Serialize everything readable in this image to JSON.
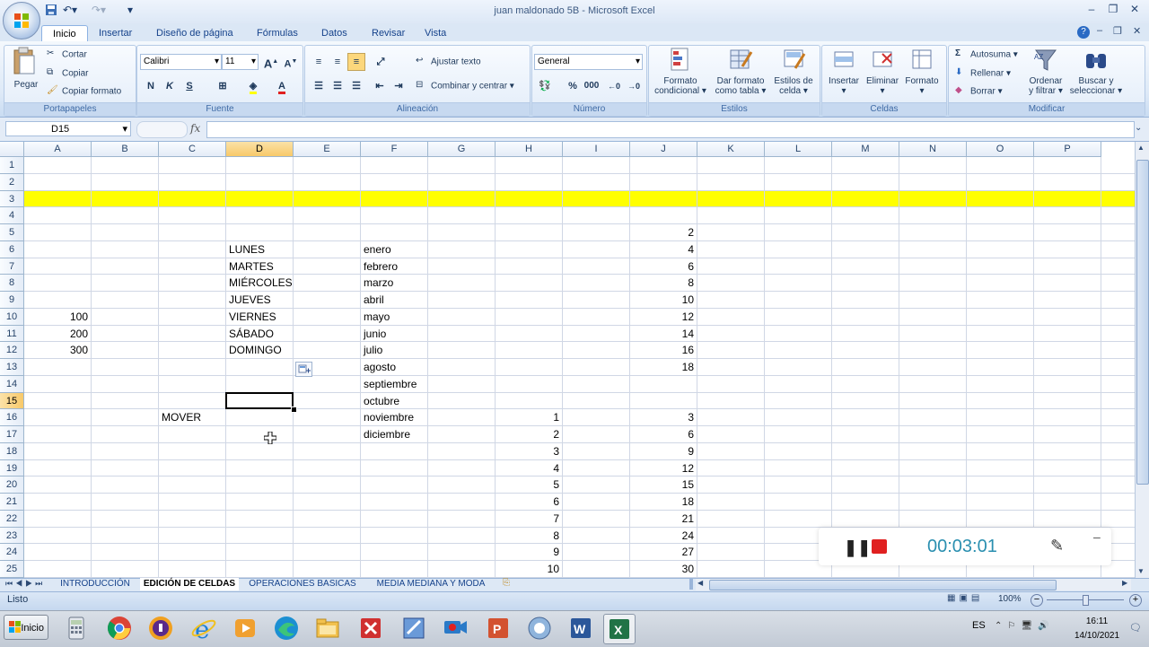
{
  "title": "juan maldonado 5B - Microsoft Excel",
  "colors": {
    "accent": "#15428b",
    "highlight_row": "#ffff00",
    "selected_header": "#f8c969"
  },
  "tabs": [
    "Inicio",
    "Insertar",
    "Diseño de página",
    "Fórmulas",
    "Datos",
    "Revisar",
    "Vista"
  ],
  "ribbon": {
    "portapapeles": {
      "paste": "Pegar",
      "cut": "Cortar",
      "copy": "Copiar",
      "format_painter": "Copiar formato",
      "label": "Portapapeles"
    },
    "fuente": {
      "font": "Calibri",
      "size": "11",
      "label": "Fuente",
      "bold": "N",
      "italic": "K",
      "underline": "S"
    },
    "alineacion": {
      "wrap": "Ajustar texto",
      "merge": "Combinar y centrar",
      "label": "Alineación"
    },
    "numero": {
      "format": "General",
      "label": "Número",
      "percent": "%",
      "thousands": "000"
    },
    "estilos": {
      "cond": "Formato condicional",
      "table": "Dar formato como tabla",
      "cell": "Estilos de celda",
      "label": "Estilos",
      "cond_l1": "Formato",
      "cond_l2": "condicional",
      "table_l1": "Dar formato",
      "table_l2": "como tabla",
      "cell_l1": "Estilos de",
      "cell_l2": "celda"
    },
    "celdas": {
      "insert": "Insertar",
      "delete": "Eliminar",
      "format": "Formato",
      "label": "Celdas"
    },
    "modificar": {
      "autosum": "Autosuma",
      "fill": "Rellenar",
      "clear": "Borrar",
      "sort_l1": "Ordenar",
      "sort_l2": "y filtrar",
      "find_l1": "Buscar y",
      "find_l2": "seleccionar",
      "label": "Modificar"
    }
  },
  "namebox": "D15",
  "fx": "fx",
  "columns": [
    "A",
    "B",
    "C",
    "D",
    "E",
    "F",
    "G",
    "H",
    "I",
    "J",
    "K",
    "L",
    "M",
    "N",
    "O",
    "P"
  ],
  "rows": [
    "1",
    "2",
    "3",
    "4",
    "5",
    "6",
    "7",
    "8",
    "9",
    "10",
    "11",
    "12",
    "13",
    "14",
    "15",
    "16",
    "17",
    "18",
    "19",
    "20",
    "21",
    "22",
    "23",
    "24",
    "25"
  ],
  "cells": {
    "J5": "2",
    "D6": "LUNES",
    "F6": "enero",
    "J6": "4",
    "D7": "MARTES",
    "F7": "febrero",
    "J7": "6",
    "D8": "MIÉRCOLES",
    "F8": "marzo",
    "J8": "8",
    "D9": "JUEVES",
    "F9": "abril",
    "J9": "10",
    "A10": "100",
    "D10": "VIERNES",
    "F10": "mayo",
    "J10": "12",
    "A11": "200",
    "D11": "SÁBADO",
    "F11": "junio",
    "J11": "14",
    "A12": "300",
    "D12": "DOMINGO",
    "F12": "julio",
    "J12": "16",
    "F13": "agosto",
    "J13": "18",
    "F14": "septiembre",
    "F15": "octubre",
    "C16": "MOVER",
    "F16": "noviembre",
    "H16": "1",
    "J16": "3",
    "F17": "diciembre",
    "H17": "2",
    "J17": "6",
    "H18": "3",
    "J18": "9",
    "H19": "4",
    "J19": "12",
    "H20": "5",
    "J20": "15",
    "H21": "6",
    "J21": "18",
    "H22": "7",
    "J22": "21",
    "H23": "8",
    "J23": "24",
    "H24": "9",
    "J24": "27",
    "H25": "10",
    "J25": "30"
  },
  "sheets": [
    "INTRODUCCIÓN",
    "EDICIÓN DE CELDAS",
    "OPERACIONES BASICAS",
    "MEDIA MEDIANA Y  MODA"
  ],
  "status": {
    "text": "Listo",
    "zoom": "100%"
  },
  "taskbar": {
    "start": "Inicio",
    "lang": "ES",
    "time": "16:11",
    "date": "14/10/2021"
  },
  "recorder": {
    "time": "00:03:01"
  }
}
